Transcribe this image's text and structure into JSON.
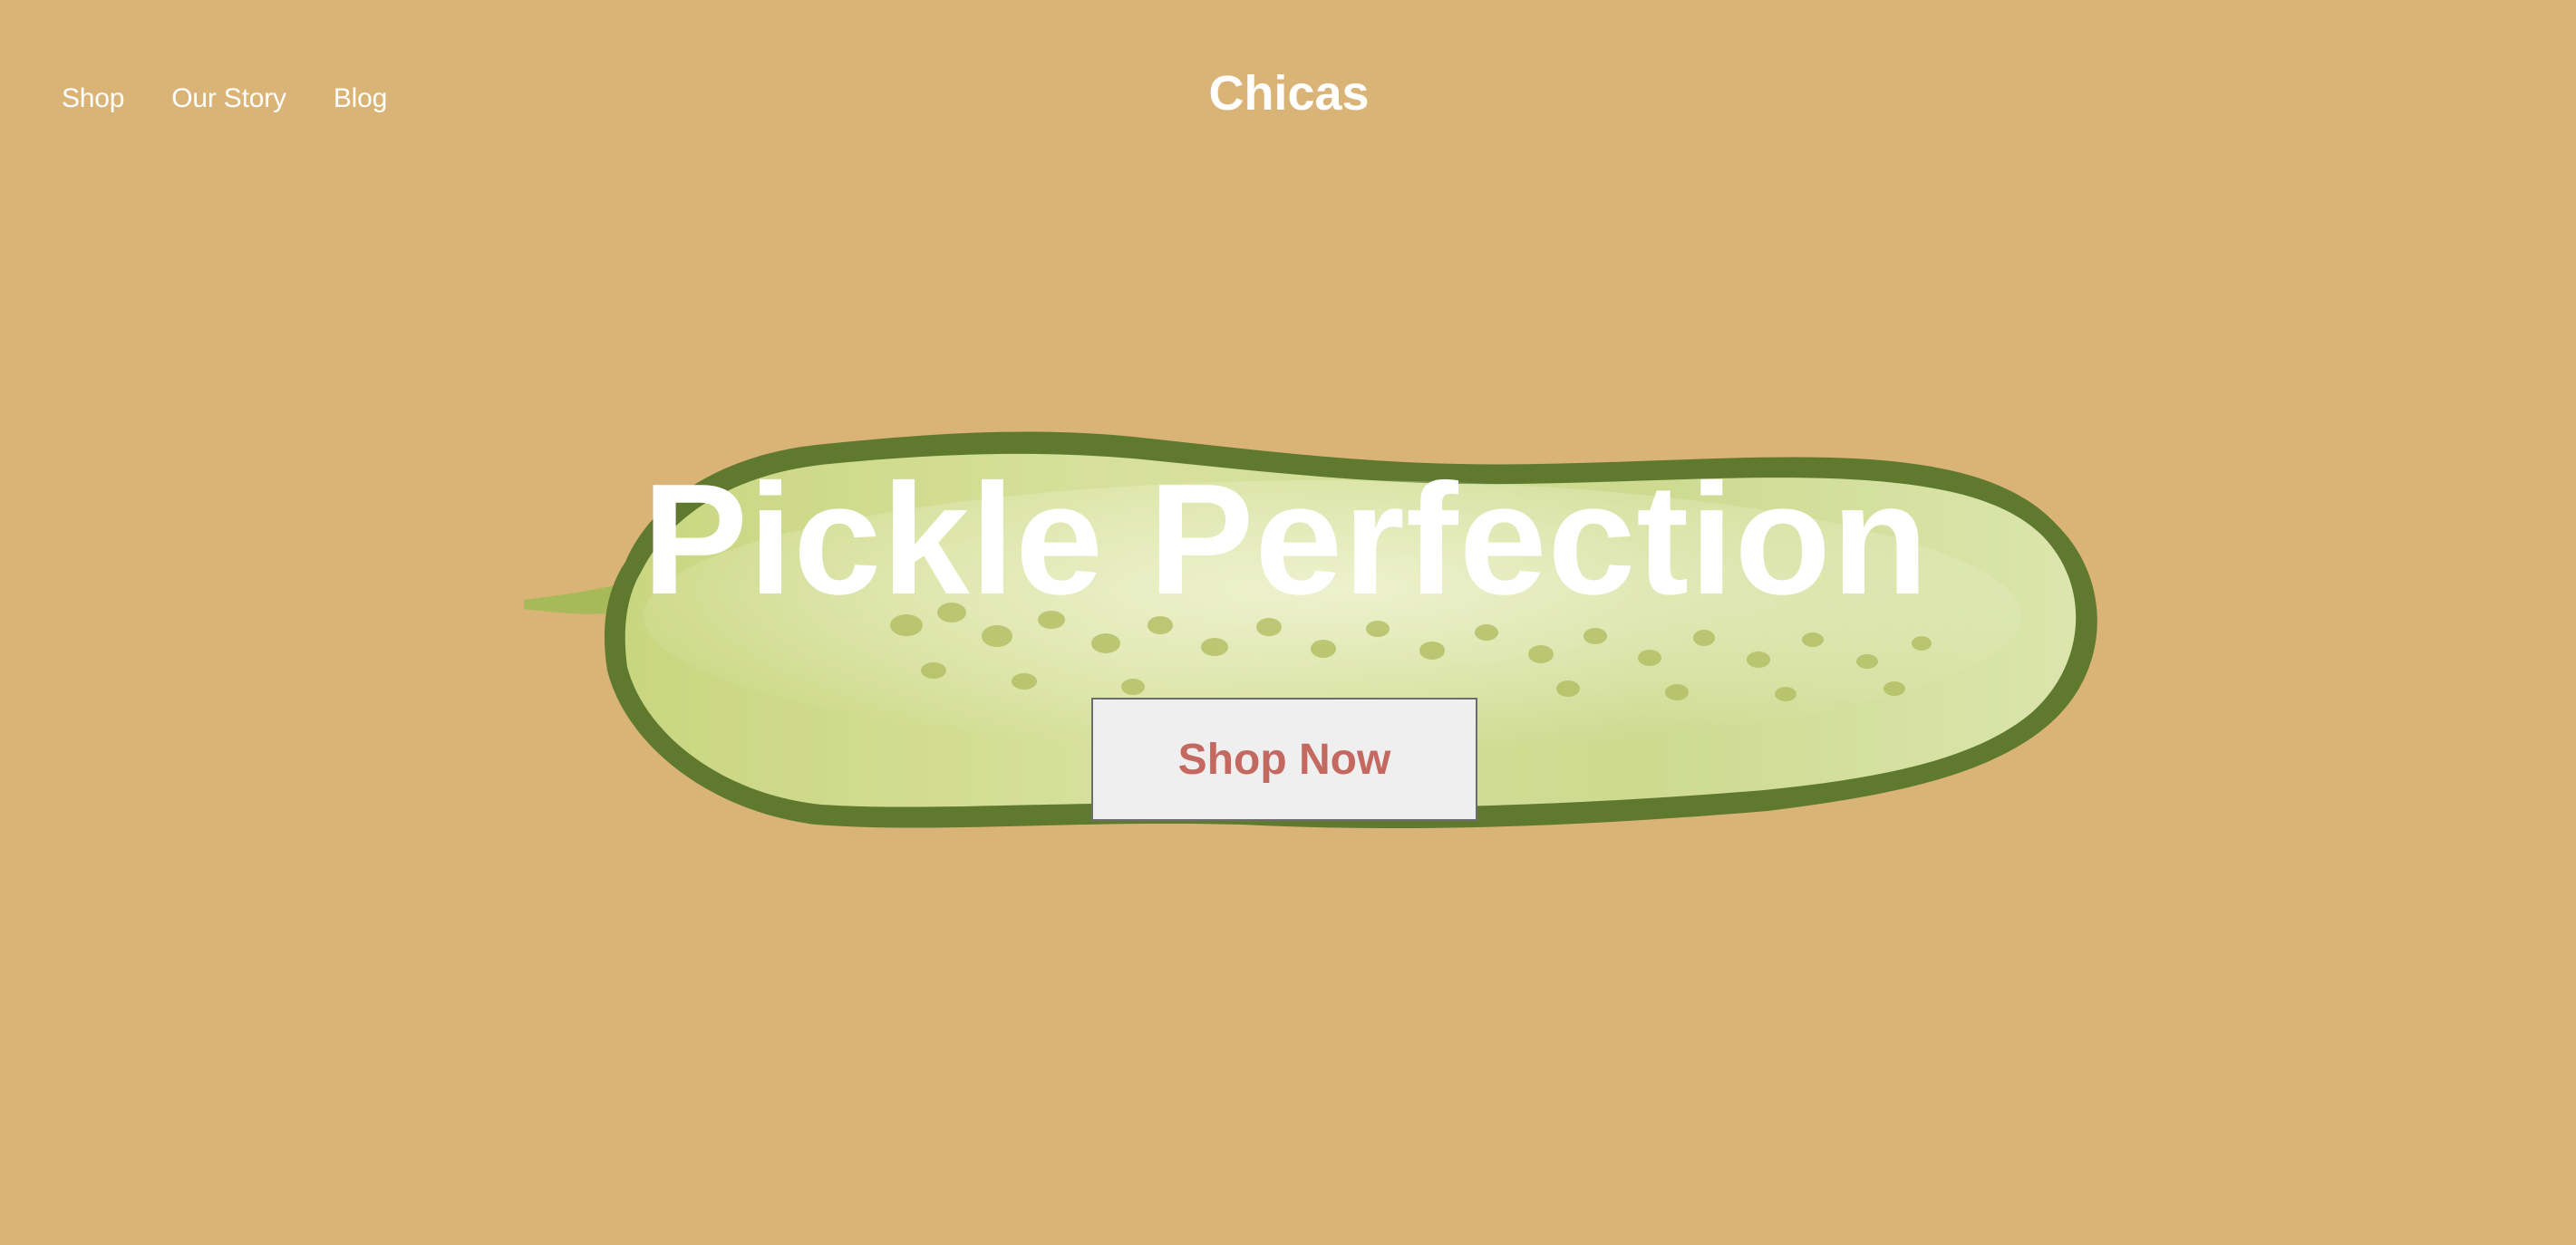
{
  "header": {
    "nav": [
      {
        "label": "Shop"
      },
      {
        "label": "Our Story"
      },
      {
        "label": "Blog"
      }
    ],
    "brand": "Chicas"
  },
  "hero": {
    "title": "Pickle Perfection",
    "cta_label": "Shop Now",
    "image": "pickle-slice-image"
  },
  "colors": {
    "background": "#dab476",
    "text": "#ffffff",
    "cta_background": "#efefef",
    "cta_text": "#c4695f"
  }
}
